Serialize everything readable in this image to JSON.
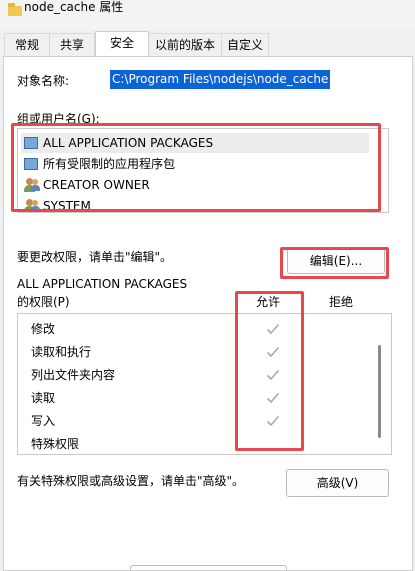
{
  "window": {
    "title": "node_cache 属性"
  },
  "tabs": [
    {
      "label": "常规"
    },
    {
      "label": "共享"
    },
    {
      "label": "安全",
      "active": true
    },
    {
      "label": "以前的版本"
    },
    {
      "label": "自定义"
    }
  ],
  "security": {
    "object_label": "对象名称:",
    "object_path": "C:\\Program Files\\nodejs\\node_cache",
    "groups_label": "组或用户名(G):",
    "groups": [
      {
        "name": "ALL APPLICATION PACKAGES",
        "icon": "package-icon"
      },
      {
        "name": "所有受限制的应用程序包",
        "icon": "package-icon"
      },
      {
        "name": "CREATOR OWNER",
        "icon": "users-icon"
      },
      {
        "name": "SYSTEM",
        "icon": "users-icon"
      }
    ],
    "edit_hint": "要更改权限，请单击\"编辑\"。",
    "edit_button": "编辑(E)...",
    "perm_for_line1": "ALL APPLICATION PACKAGES",
    "perm_for_line2": "的权限(P)",
    "col_allow": "允许",
    "col_deny": "拒绝",
    "permissions": [
      {
        "name": "修改",
        "allow": true,
        "deny": false
      },
      {
        "name": "读取和执行",
        "allow": true,
        "deny": false
      },
      {
        "name": "列出文件夹内容",
        "allow": true,
        "deny": false
      },
      {
        "name": "读取",
        "allow": true,
        "deny": false
      },
      {
        "name": "写入",
        "allow": true,
        "deny": false
      },
      {
        "name": "特殊权限",
        "allow": false,
        "deny": false
      }
    ],
    "advanced_hint": "有关特殊权限或高级设置，请单击\"高级\"。",
    "advanced_button": "高级(V)"
  },
  "colors": {
    "selection": "#0b63d8",
    "annotation": "#e8484b",
    "check": "#a9a9a9"
  }
}
